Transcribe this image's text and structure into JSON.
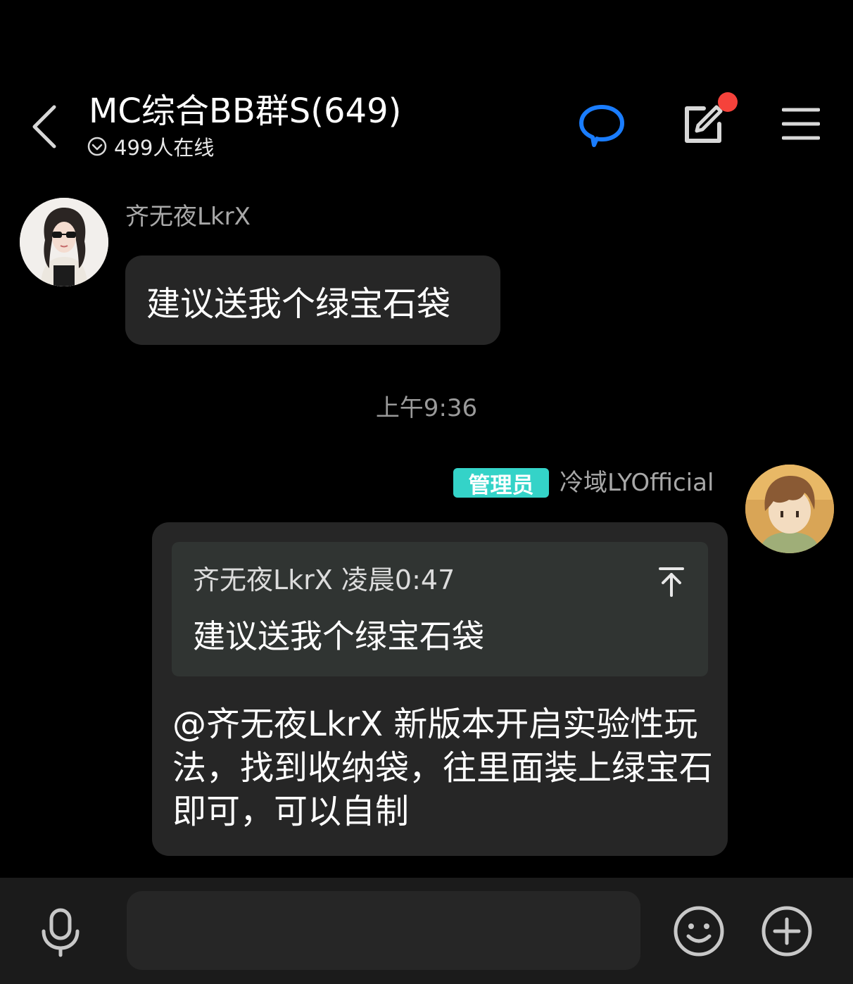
{
  "header": {
    "title": "MC综合BB群S(649)",
    "online_status": "499人在线",
    "icons": {
      "back": "chevron-left-icon",
      "online": "chevron-down-circle-icon",
      "chat": "chat-bubble-icon",
      "edit": "edit-note-icon",
      "menu": "menu-icon"
    },
    "colors": {
      "chat_icon": "#1a7dff",
      "notification_dot": "#f5423b"
    }
  },
  "messages": {
    "first": {
      "sender": "齐无夜LkrX",
      "text": "建议送我个绿宝石袋"
    },
    "timestamp": "上午9:36",
    "second": {
      "badge": "管理员",
      "sender": "冷域LYOfficial",
      "quote_meta": "齐无夜LkrX 凌晨0:47",
      "quote_text": "建议送我个绿宝石袋",
      "reply_text": "@齐无夜LkrX 新版本开启实验性玩法，找到收纳袋，往里面装上绿宝石即可，可以自制"
    },
    "colors": {
      "badge": "#34d3c8",
      "bubble": "#262626",
      "quote": "#303432"
    }
  },
  "input_bar": {
    "placeholder": "",
    "icons": {
      "mic": "microphone-icon",
      "emoji": "smiley-icon",
      "plus": "plus-circle-icon"
    }
  }
}
